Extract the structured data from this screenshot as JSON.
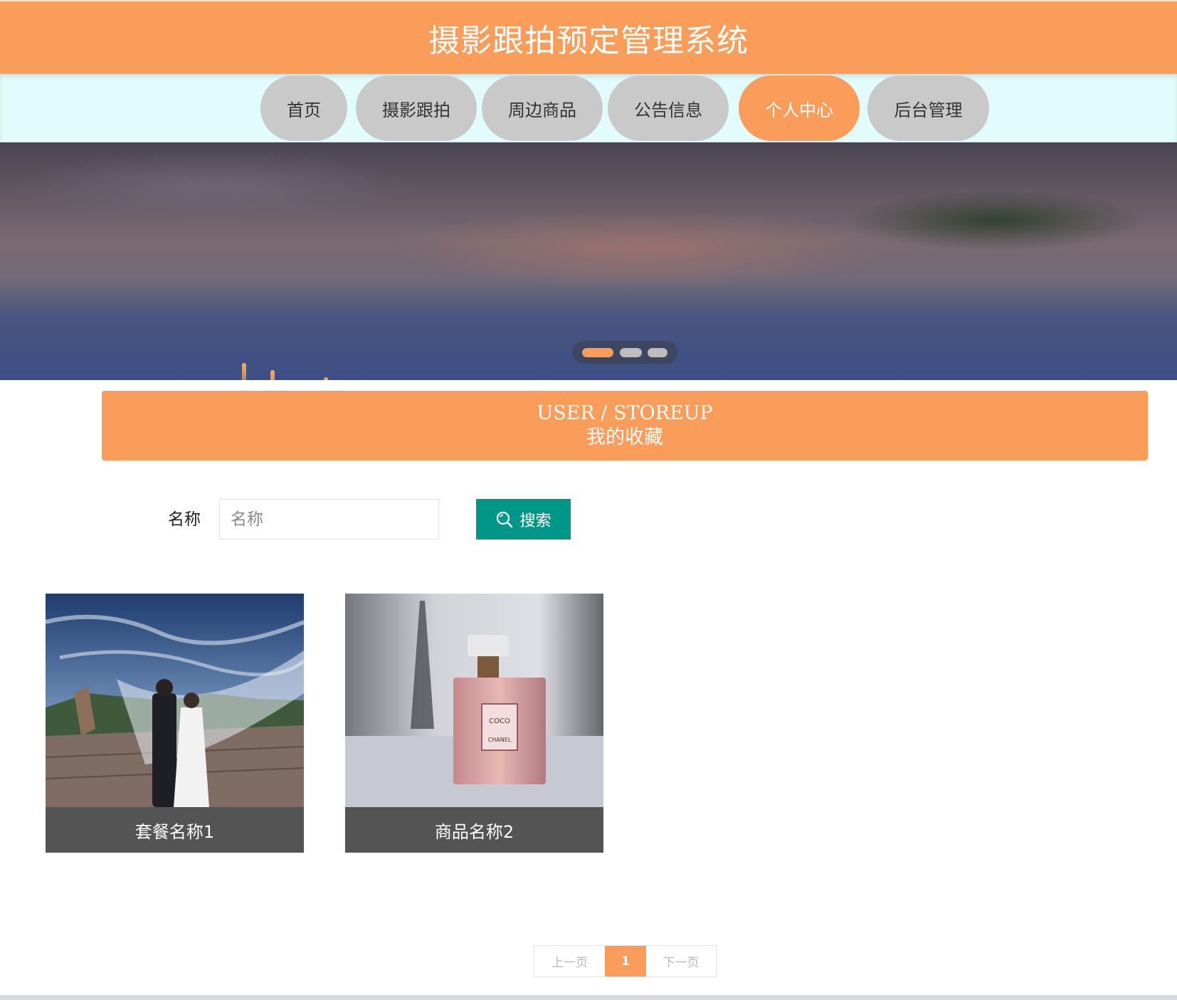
{
  "header": {
    "title": "摄影跟拍预定管理系统"
  },
  "nav": {
    "items": [
      {
        "label": "首页"
      },
      {
        "label": "摄影跟拍"
      },
      {
        "label": "周边商品"
      },
      {
        "label": "公告信息"
      },
      {
        "label": "个人中心",
        "active": true
      },
      {
        "label": "后台管理"
      }
    ]
  },
  "banner": {
    "slide_count": 3,
    "active_slide": 1
  },
  "section": {
    "title_en": "USER / STOREUP",
    "title_zh": "我的收藏"
  },
  "search": {
    "label": "名称",
    "placeholder": "名称",
    "value": "",
    "button_label": "搜索"
  },
  "items": [
    {
      "name": "套餐名称1"
    },
    {
      "name": "商品名称2"
    }
  ],
  "pagination": {
    "prev_label": "上一页",
    "current_page": "1",
    "next_label": "下一页"
  },
  "colors": {
    "accent": "#fb9d5a",
    "nav_bg": "#e2fcfd",
    "nav_inactive": "#c9c9c9",
    "search_button": "#009688",
    "caption_bg": "#545454"
  }
}
